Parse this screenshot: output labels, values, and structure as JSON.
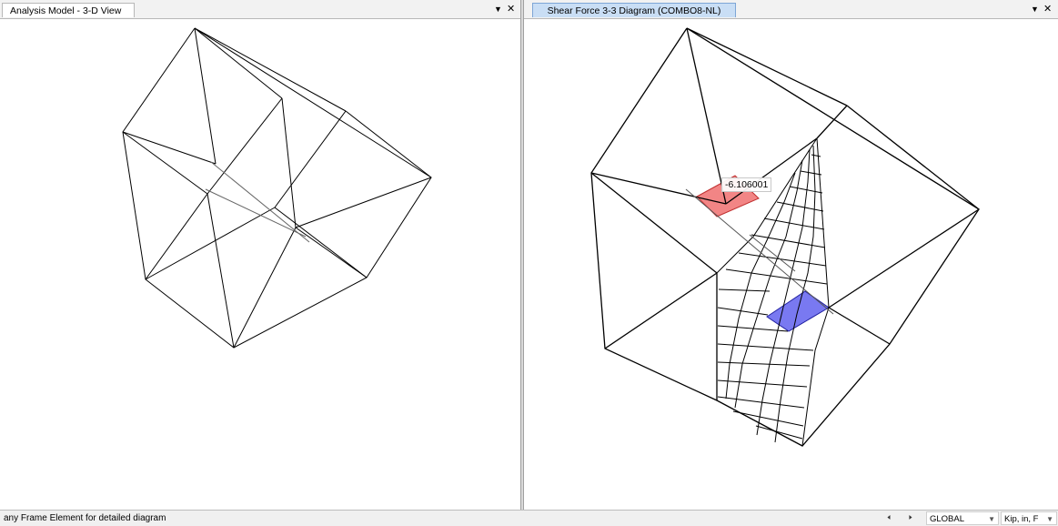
{
  "left_panel": {
    "tab_title": "Analysis Model - 3-D View",
    "menu_icon": "chevron-down-icon",
    "close_icon": "close-icon"
  },
  "right_panel": {
    "tab_title": "Shear Force 3-3 Diagram (COMBO8-NL)",
    "menu_icon": "chevron-down-icon",
    "close_icon": "close-icon",
    "tooltip_value": "-6.106001",
    "positive_fill": "#f07070",
    "negative_fill": "#6a6af0"
  },
  "status_bar": {
    "message": "any Frame Element for detailed diagram",
    "prev_icon": "arrow-left-icon",
    "next_icon": "arrow-right-icon",
    "coord_system": "GLOBAL",
    "units": "Kip, in, F"
  }
}
